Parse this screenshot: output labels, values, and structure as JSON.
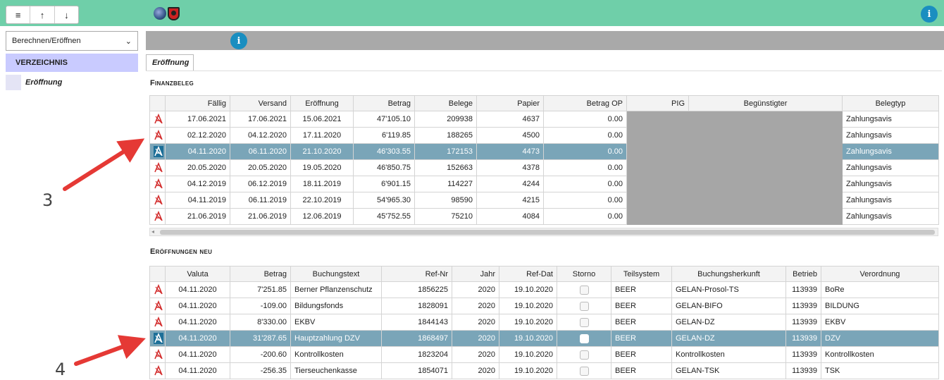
{
  "topbar": {
    "menu_icon": "hamburger-icon",
    "up_icon": "arrow-up-icon",
    "down_icon": "arrow-down-icon",
    "info_label": "i"
  },
  "sidebar": {
    "select_value": "Berechnen/Eröffnen",
    "header": "VERZEICHNIS",
    "items": [
      {
        "label": "Eröffnung"
      }
    ]
  },
  "info2_label": "i",
  "tab": {
    "label": "Eröffnung"
  },
  "finanzbeleg": {
    "title": "Finanzbeleg",
    "columns": [
      "Fällig",
      "Versand",
      "Eröffnung",
      "Betrag",
      "Belege",
      "Papier",
      "Betrag OP",
      "PIG",
      "Begünstigter",
      "Belegtyp"
    ],
    "rows": [
      [
        "17.06.2021",
        "17.06.2021",
        "15.06.2021",
        "47'105.10",
        "209938",
        "4637",
        "0.00",
        "",
        "",
        "Zahlungsavis"
      ],
      [
        "02.12.2020",
        "04.12.2020",
        "17.11.2020",
        "6'119.85",
        "188265",
        "4500",
        "0.00",
        "",
        "",
        "Zahlungsavis"
      ],
      [
        "04.11.2020",
        "06.11.2020",
        "21.10.2020",
        "46'303.55",
        "172153",
        "4473",
        "0.00",
        "",
        "",
        "Zahlungsavis"
      ],
      [
        "20.05.2020",
        "20.05.2020",
        "19.05.2020",
        "46'850.75",
        "152663",
        "4378",
        "0.00",
        "",
        "",
        "Zahlungsavis"
      ],
      [
        "04.12.2019",
        "06.12.2019",
        "18.11.2019",
        "6'901.15",
        "114227",
        "4244",
        "0.00",
        "",
        "",
        "Zahlungsavis"
      ],
      [
        "04.11.2019",
        "06.11.2019",
        "22.10.2019",
        "54'965.30",
        "98590",
        "4215",
        "0.00",
        "",
        "",
        "Zahlungsavis"
      ],
      [
        "21.06.2019",
        "21.06.2019",
        "12.06.2019",
        "45'752.55",
        "75210",
        "4084",
        "0.00",
        "",
        "",
        "Zahlungsavis"
      ]
    ],
    "selected_index": 2
  },
  "eroeffnungen": {
    "title": "Eröffnungen neu",
    "columns": [
      "Valuta",
      "Betrag",
      "Buchungstext",
      "Ref-Nr",
      "Jahr",
      "Ref-Dat",
      "Storno",
      "Teilsystem",
      "Buchungsherkunft",
      "Betrieb",
      "Verordnung"
    ],
    "rows": [
      [
        "04.11.2020",
        "7'251.85",
        "Berner Pflanzenschutz",
        "1856225",
        "2020",
        "19.10.2020",
        "",
        "BEER",
        "GELAN-Prosol-TS",
        "113939",
        "BoRe"
      ],
      [
        "04.11.2020",
        "-109.00",
        "Bildungsfonds",
        "1828091",
        "2020",
        "19.10.2020",
        "",
        "BEER",
        "GELAN-BIFO",
        "113939",
        "BILDUNG"
      ],
      [
        "04.11.2020",
        "8'330.00",
        "EKBV",
        "1844143",
        "2020",
        "19.10.2020",
        "",
        "BEER",
        "GELAN-DZ",
        "113939",
        "EKBV"
      ],
      [
        "04.11.2020",
        "31'287.65",
        "Hauptzahlung DZV",
        "1868497",
        "2020",
        "19.10.2020",
        "",
        "BEER",
        "GELAN-DZ",
        "113939",
        "DZV"
      ],
      [
        "04.11.2020",
        "-200.60",
        "Kontrollkosten",
        "1823204",
        "2020",
        "19.10.2020",
        "",
        "BEER",
        "Kontrollkosten",
        "113939",
        "Kontrollkosten"
      ],
      [
        "04.11.2020",
        "-256.35",
        "Tierseuchenkasse",
        "1854071",
        "2020",
        "19.10.2020",
        "",
        "BEER",
        "GELAN-TSK",
        "113939",
        "TSK"
      ]
    ],
    "selected_index": 3
  },
  "annotations": [
    {
      "label": "3"
    },
    {
      "label": "4"
    }
  ],
  "colors": {
    "topbar": "#6fcfa9",
    "selected_row": "#7aa5b8",
    "info": "#1a8ec0",
    "arrow": "#e53935"
  }
}
